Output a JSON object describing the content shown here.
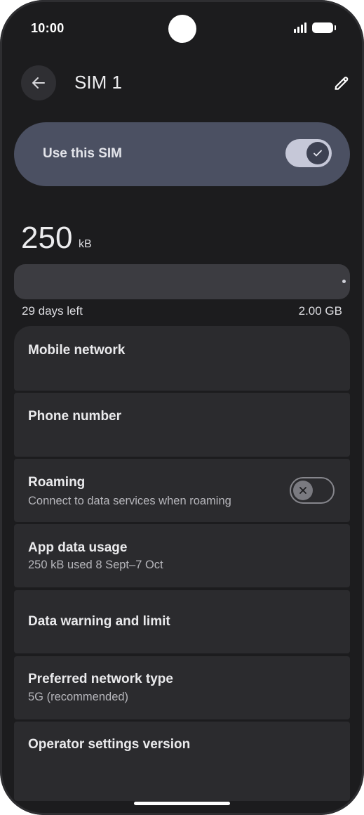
{
  "status_bar": {
    "time": "10:00",
    "icons": [
      "signal-icon",
      "battery-icon"
    ]
  },
  "app_bar": {
    "title": "SIM 1",
    "back_icon": "arrow-left-icon",
    "edit_icon": "pencil-icon"
  },
  "use_sim": {
    "label": "Use this SIM",
    "enabled": true
  },
  "usage": {
    "value": "250",
    "unit": "kB",
    "fill_fraction": 0.0,
    "days_left": "29 days left",
    "limit": "2.00 GB"
  },
  "list": [
    {
      "title": "Mobile network"
    },
    {
      "title": "Phone number"
    },
    {
      "title": "Roaming",
      "subtitle": "Connect to data services when roaming",
      "toggle": false
    },
    {
      "title": "App data usage",
      "subtitle": "250 kB used 8 Sept–7 Oct"
    },
    {
      "title": "Data warning and limit"
    },
    {
      "title": "Preferred network type",
      "subtitle": "5G (recommended)"
    },
    {
      "title": "Operator settings version"
    }
  ],
  "colors": {
    "background": "#1c1c1e",
    "card": "#2b2b2e",
    "accent_card": "#4b5062",
    "toggle_on": "#c6c8d8"
  }
}
